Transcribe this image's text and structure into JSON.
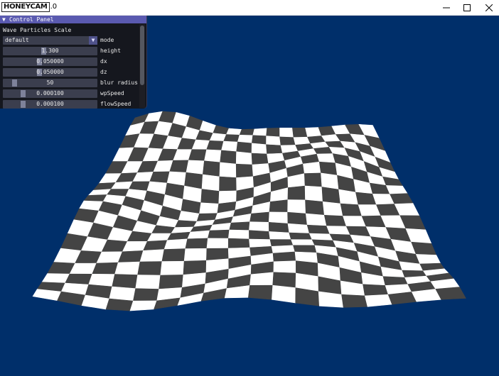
{
  "window": {
    "app_logo_text": "HONEYCAM",
    "app_title_suffix": ".0",
    "controls": [
      "minimize",
      "maximize",
      "close"
    ]
  },
  "panel": {
    "title": "Control Panel",
    "collapse_icon": "triangle-down-icon",
    "section": "Wave Particles Scale",
    "mode": {
      "value": "default",
      "label": "mode"
    },
    "sliders": [
      {
        "value": "1.300",
        "label": "height",
        "fraction": 0.43
      },
      {
        "value": "0.050000",
        "label": "dx",
        "fraction": 0.38
      },
      {
        "value": "0.050000",
        "label": "dz",
        "fraction": 0.38
      },
      {
        "value": "50",
        "label": "blur radius",
        "fraction": 0.1
      },
      {
        "value": "0.000100",
        "label": "wpSpeed",
        "fraction": 0.2
      },
      {
        "value": "0.000100",
        "label": "flowSpeed",
        "fraction": 0.2
      }
    ]
  },
  "colors": {
    "viewport_bg": "#002f6a",
    "panel_header": "#5a5ab0",
    "checker_dark": "#444444",
    "checker_light": "#ffffff"
  }
}
